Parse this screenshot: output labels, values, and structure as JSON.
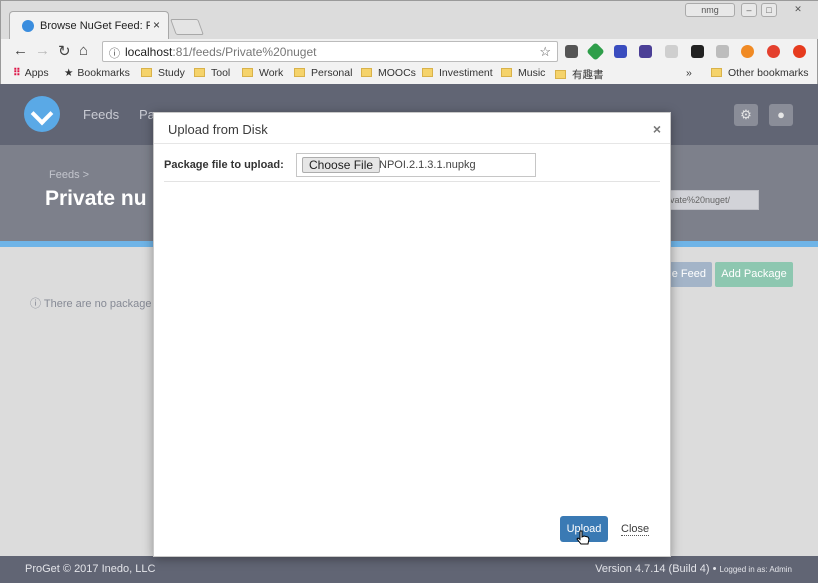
{
  "browser": {
    "tab_title": "Browse NuGet Feed: Priv",
    "tab_close": "×",
    "profile_badge": "nmg",
    "url_host": "localhost",
    "url_path": ":81/feeds/Private%20nuget",
    "bookmarks": [
      "Apps",
      "Bookmarks",
      "Study",
      "Tool",
      "Work",
      "Personal",
      "MOOCs",
      "Investiment",
      "Music",
      "有趣書"
    ],
    "bookmarks_overflow": "»",
    "other_bookmarks": "Other bookmarks"
  },
  "navbar": {
    "links": [
      "Feeds",
      "Pa"
    ]
  },
  "header": {
    "breadcrumb": "Feeds >",
    "title": "Private nu",
    "feed_url": "ivate%20nuget/"
  },
  "content": {
    "feed_button": "ge Feed",
    "add_package": "Add Package",
    "empty_message": "There are no package"
  },
  "footer": {
    "copyright": "ProGet © 2017 Inedo, LLC",
    "version": "Version 4.7.14 (Build 4) •",
    "logged_in": "Logged in as: Admin"
  },
  "modal": {
    "title": "Upload from Disk",
    "close_glyph": "×",
    "field_label": "Package file to upload:",
    "choose_file": "Choose File",
    "file_name": "NPOI.2.1.3.1.nupkg",
    "upload": "Upload",
    "close": "Close"
  },
  "colors": {
    "navbar": "#616574",
    "header": "#7d808b",
    "accent": "#6fb4e7",
    "upload_button": "#3a7ab4",
    "add_package": "#8dc7b0"
  }
}
